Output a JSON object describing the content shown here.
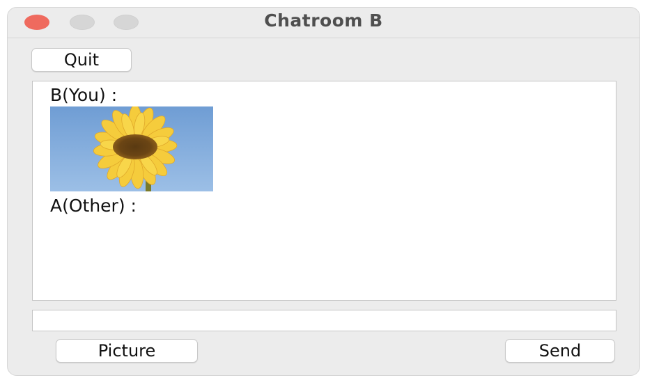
{
  "window": {
    "title": "Chatroom B"
  },
  "toolbar": {
    "quit_label": "Quit"
  },
  "chat": {
    "messages": [
      {
        "sender": "B(You) :",
        "content_type": "image",
        "image_subject": "sunflower-photo"
      },
      {
        "sender": "A(Other) :",
        "content_type": "text"
      }
    ]
  },
  "composer": {
    "input_value": "",
    "picture_label": "Picture",
    "send_label": "Send"
  },
  "colors": {
    "close_button": "#ef6a5e",
    "window_background": "#ececec",
    "sky": "#7ea8d8",
    "petal": "#f5cc3c"
  }
}
